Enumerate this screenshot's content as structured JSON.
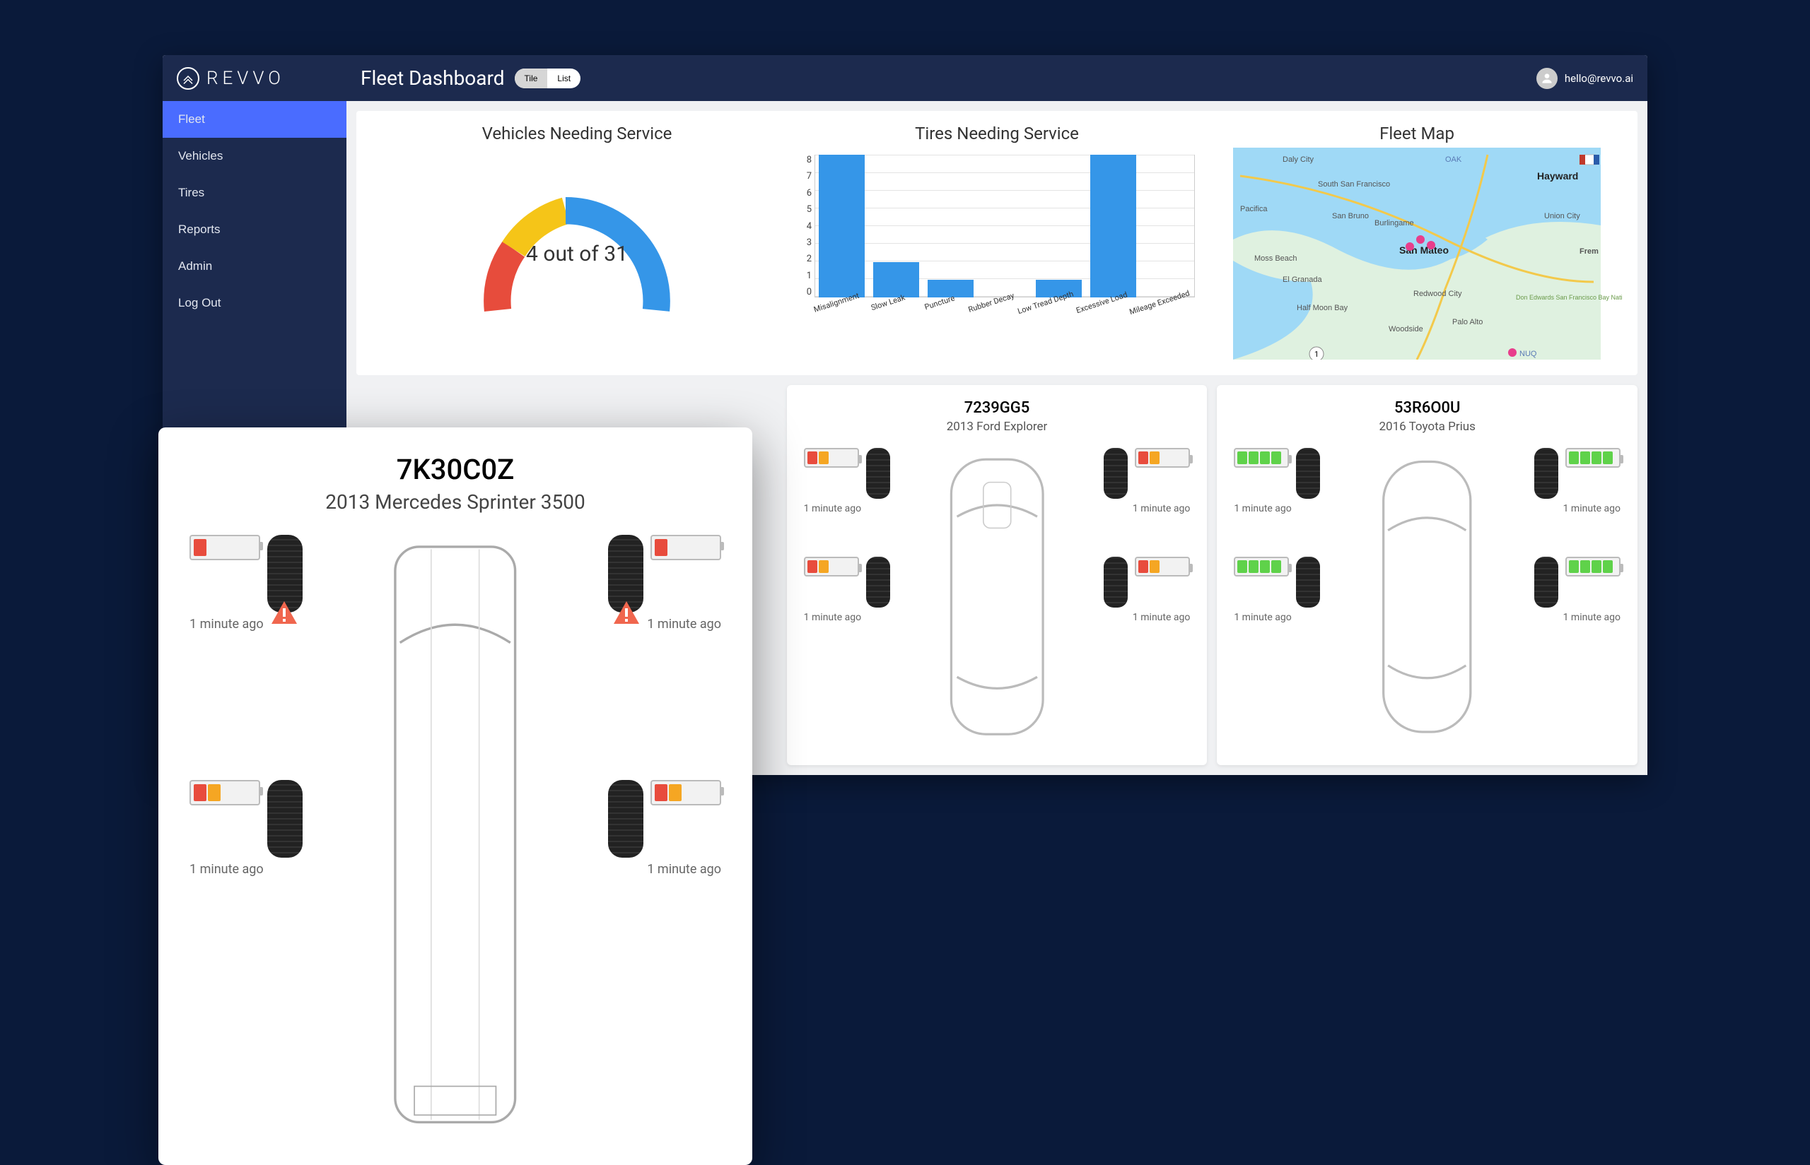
{
  "brand": "REVVO",
  "header": {
    "title": "Fleet Dashboard",
    "view_tile": "Tile",
    "view_list": "List",
    "user_email": "hello@revvo.ai"
  },
  "sidebar": {
    "items": [
      {
        "label": "Fleet",
        "active": true
      },
      {
        "label": "Vehicles",
        "active": false
      },
      {
        "label": "Tires",
        "active": false
      },
      {
        "label": "Reports",
        "active": false
      },
      {
        "label": "Admin",
        "active": false
      },
      {
        "label": "Log Out",
        "active": false
      }
    ]
  },
  "cards": {
    "vehicles_service": {
      "title": "Vehicles Needing Service",
      "label": "4 out of 31"
    },
    "tires_service": {
      "title": "Tires Needing Service"
    },
    "fleet_map": {
      "title": "Fleet Map",
      "places": [
        "Daly City",
        "South San Francisco",
        "Pacifica",
        "San Bruno",
        "Moss Beach",
        "El Granada",
        "Half Moon Bay",
        "Burlingame",
        "San Mateo",
        "Redwood City",
        "Woodside",
        "Palo Alto",
        "Hayward",
        "Union City",
        "Frem",
        "Don Edwards San Francisco Bay National Wildlife Refuge",
        "OAK",
        "NUQ"
      ]
    }
  },
  "chart_data": {
    "type": "bar",
    "title": "Tires Needing Service",
    "categories": [
      "Misalignment",
      "Slow Leak",
      "Puncture",
      "Rubber Decay",
      "Low Tread Depth",
      "Excessive Load",
      "Mileage Exceeded"
    ],
    "values": [
      8,
      2,
      1,
      0,
      1,
      8,
      0
    ],
    "yticks": [
      0,
      1,
      2,
      3,
      4,
      5,
      6,
      7,
      8
    ],
    "ylim": [
      0,
      8
    ],
    "xlabel": "",
    "ylabel": ""
  },
  "featured_vehicle": {
    "plate": "7K30C0Z",
    "name": "2013 Mercedes Sprinter 3500",
    "tires": [
      {
        "segs": [
          "red"
        ],
        "ts": "1 minute ago",
        "warn": true
      },
      {
        "segs": [
          "red"
        ],
        "ts": "1 minute ago",
        "warn": true
      },
      {
        "segs": [
          "red",
          "orange"
        ],
        "ts": "1 minute ago",
        "warn": false
      },
      {
        "segs": [
          "red",
          "orange"
        ],
        "ts": "1 minute ago",
        "warn": false
      }
    ]
  },
  "vehicles": [
    {
      "plate": "7239GG5",
      "name": "2013 Ford Explorer",
      "tires": [
        {
          "segs": [
            "red",
            "orange"
          ],
          "ts": "1 minute ago"
        },
        {
          "segs": [
            "red",
            "orange"
          ],
          "ts": "1 minute ago"
        },
        {
          "segs": [
            "red",
            "orange"
          ],
          "ts": "1 minute ago"
        },
        {
          "segs": [
            "red",
            "orange"
          ],
          "ts": "1 minute ago"
        }
      ]
    },
    {
      "plate": "53R6O0U",
      "name": "2016 Toyota Prius",
      "tires": [
        {
          "segs": [
            "green",
            "green",
            "green",
            "green"
          ],
          "ts": "1 minute ago"
        },
        {
          "segs": [
            "green",
            "green",
            "green",
            "green"
          ],
          "ts": "1 minute ago"
        },
        {
          "segs": [
            "green",
            "green",
            "green",
            "green"
          ],
          "ts": "1 minute ago"
        },
        {
          "segs": [
            "green",
            "green",
            "green",
            "green"
          ],
          "ts": "1 minute ago"
        }
      ]
    }
  ]
}
